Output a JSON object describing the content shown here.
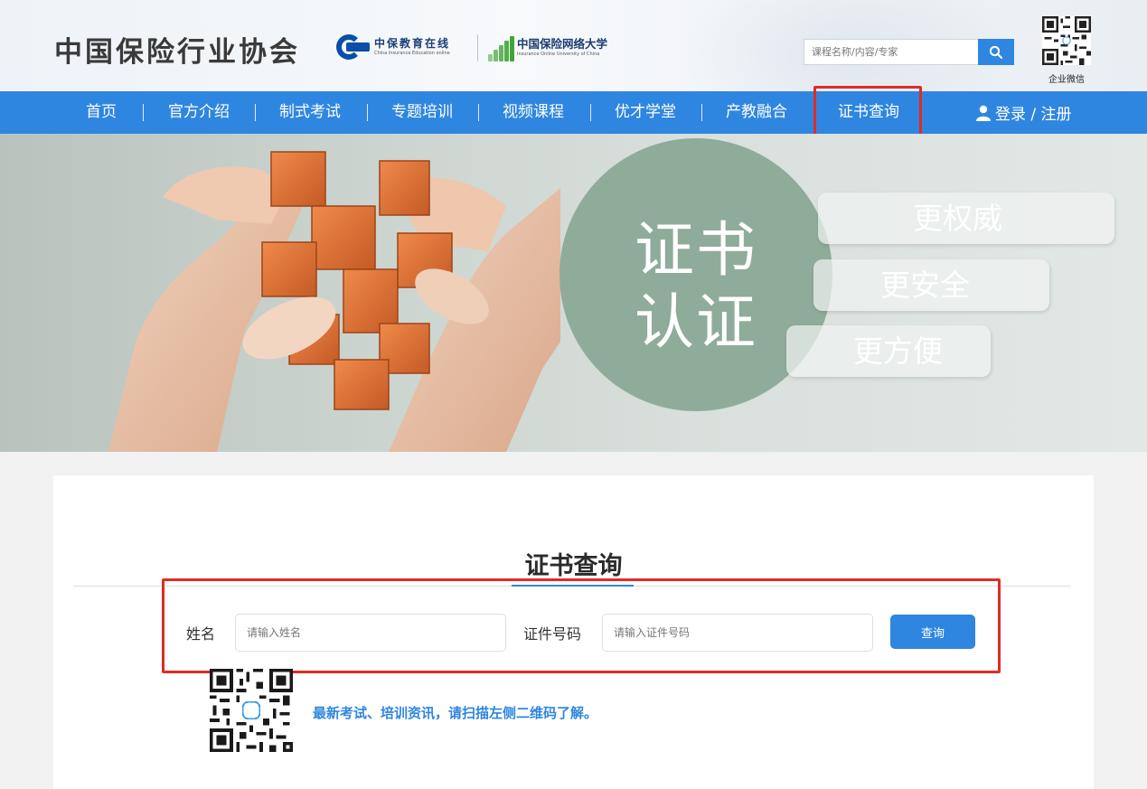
{
  "header": {
    "brand": "中国保险行业协会",
    "partner1": {
      "name": "中保教育在线",
      "subtitle": "China Insurance Education online"
    },
    "partner2": {
      "name": "中国保险网络大学",
      "subtitle": "Insurance Online University of China"
    },
    "search_placeholder": "课程名称/内容/专家",
    "search_icon": "search-icon",
    "qr_caption": "企业微信"
  },
  "nav": {
    "items": [
      "首页",
      "官方介绍",
      "制式考试",
      "专题培训",
      "视频课程",
      "优才学堂",
      "产教融合",
      "证书查询"
    ],
    "active": "证书查询",
    "login": "登录 / 注册",
    "user_icon": "user-icon"
  },
  "banner": {
    "circle_line1": "证书",
    "circle_line2": "认证",
    "pills": [
      "更权威",
      "更安全",
      "更方便"
    ]
  },
  "content": {
    "title": "证书查询",
    "name_label": "姓名",
    "name_placeholder": "请输入姓名",
    "id_label": "证件号码",
    "id_placeholder": "请输入证件号码",
    "query_button": "查询",
    "note": "最新考试、培训资讯，请扫描左侧二维码了解。"
  },
  "colors": {
    "primary": "#2f86e0",
    "highlight": "#e12b25",
    "circle": "#8fac9b"
  }
}
